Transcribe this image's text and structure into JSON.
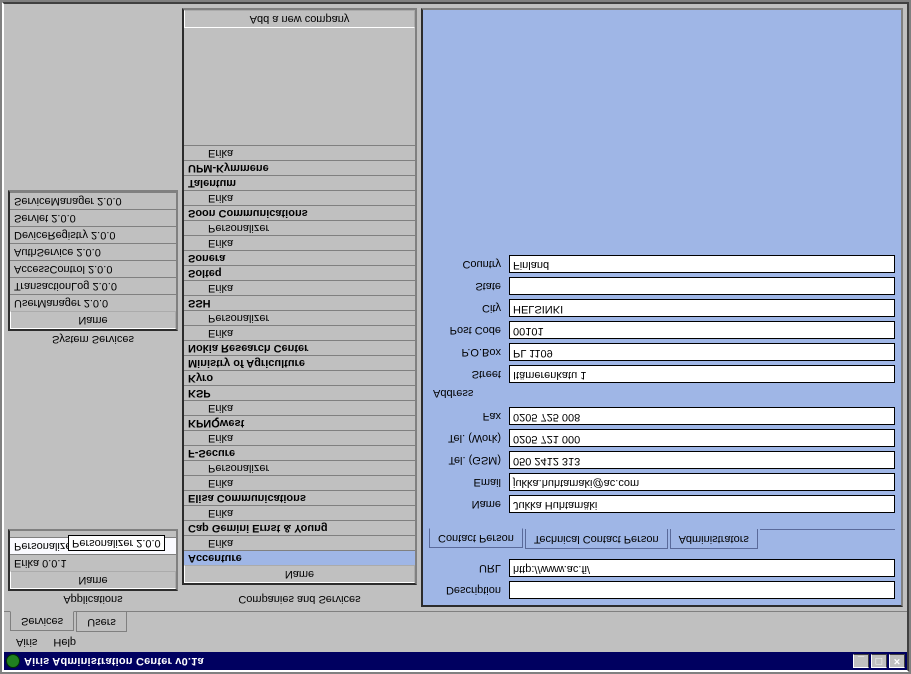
{
  "window": {
    "title": "Airis Administration Center v0.1a"
  },
  "menu": {
    "airis": "Airis",
    "help": "Help"
  },
  "tabs": {
    "services": "Services",
    "users": "Users"
  },
  "applications": {
    "title": "Applications",
    "header": "Name",
    "items": [
      "Erika 0.0.1",
      "Personalize..."
    ],
    "tooltip": "Personalizer 2.0.0"
  },
  "system_services": {
    "title": "System Services",
    "header": "Name",
    "items": [
      "UserManager 2.0.0",
      "TransactionLog 2.0.0",
      "AccessControl 2.0.0",
      "AuthService 2.0.0",
      "DeviceRegistry 2.0.0",
      "Servlet 2.0.0",
      "ServiceManager 2.0.0"
    ]
  },
  "companies": {
    "title": "Companies and Services",
    "header": "Name",
    "footer": "Add a new company",
    "tree": [
      {
        "label": "Accenture",
        "bold": true,
        "sel": true
      },
      {
        "label": "Erika",
        "indent": true
      },
      {
        "label": "Cap Gemini Ernst & Young",
        "bold": true
      },
      {
        "label": "Erika",
        "indent": true
      },
      {
        "label": "Elisa Communications",
        "bold": true
      },
      {
        "label": "Erika",
        "indent": true
      },
      {
        "label": "Personalizer",
        "indent": true
      },
      {
        "label": "F-Secure",
        "bold": true
      },
      {
        "label": "Erika",
        "indent": true
      },
      {
        "label": "KPNQwest",
        "bold": true
      },
      {
        "label": "Erika",
        "indent": true
      },
      {
        "label": "KSP",
        "bold": true
      },
      {
        "label": "Kyro",
        "bold": true
      },
      {
        "label": "Ministry of Agriculture",
        "bold": true
      },
      {
        "label": "Nokia Research Center",
        "bold": true
      },
      {
        "label": "Erika",
        "indent": true
      },
      {
        "label": "Personalizer",
        "indent": true
      },
      {
        "label": "SSH",
        "bold": true
      },
      {
        "label": "Erika",
        "indent": true
      },
      {
        "label": "Solteq",
        "bold": true
      },
      {
        "label": "Sonera",
        "bold": true
      },
      {
        "label": "Erika",
        "indent": true
      },
      {
        "label": "Personalizer",
        "indent": true
      },
      {
        "label": "Soon Communications",
        "bold": true
      },
      {
        "label": "Erika",
        "indent": true
      },
      {
        "label": "Talentum",
        "bold": true
      },
      {
        "label": "UPM-Kymmene",
        "bold": true
      },
      {
        "label": "Erika",
        "indent": true
      }
    ]
  },
  "detail": {
    "description_label": "Description",
    "description": "",
    "url_label": "URL",
    "url": "http://www.ac.fi/",
    "tabs": {
      "contact": "Contact Person",
      "technical": "Technical Contact Person",
      "admins": "Administrators"
    },
    "name_label": "Name",
    "name": "Jukka Huhtamäki",
    "email_label": "Email",
    "email": "jukka.huhtamaki@ac.com",
    "tel_gsm_label": "Tel. (GSM)",
    "tel_gsm": "050 2412 313",
    "tel_work_label": "Tel. (Work)",
    "tel_work": "0205 721 000",
    "fax_label": "Fax",
    "fax": "0205 725 008",
    "address_label": "Address",
    "street_label": "Street",
    "street": "Itämerenkatu 1",
    "pobox_label": "P.O.Box",
    "pobox": "PL 1109",
    "postcode_label": "Post Code",
    "postcode": "00101",
    "city_label": "City",
    "city": "HELSINKI",
    "state_label": "State",
    "state": "",
    "country_label": "Country",
    "country": "Finland"
  }
}
